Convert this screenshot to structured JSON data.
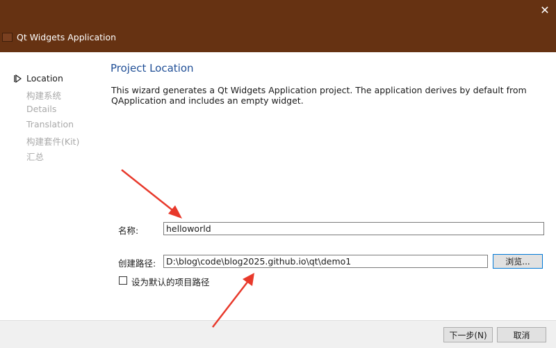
{
  "window": {
    "title": "Qt Widgets Application",
    "close_label": "✕"
  },
  "sidebar": {
    "marker_icon": "triangle-right-icon",
    "steps": [
      {
        "label": "Location",
        "active": true
      },
      {
        "label": "构建系统",
        "active": false
      },
      {
        "label": "Details",
        "active": false
      },
      {
        "label": "Translation",
        "active": false
      },
      {
        "label": "构建套件(Kit)",
        "active": false
      },
      {
        "label": "汇总",
        "active": false
      }
    ]
  },
  "page": {
    "title": "Project Location",
    "description": "This wizard generates a Qt Widgets Application project. The application derives by default from QApplication and includes an empty widget."
  },
  "form": {
    "name_label": "名称:",
    "name_value": "helloworld",
    "path_label": "创建路径:",
    "path_value": "D:\\blog\\code\\blog2025.github.io\\qt\\demo1",
    "browse_label": "浏览...",
    "default_path_label": "设为默认的项目路径",
    "default_path_checked": false
  },
  "footer": {
    "next_label": "下一步(N)",
    "cancel_label": "取消"
  },
  "colors": {
    "titlebar": "#663212",
    "accent_title": "#1f4e96",
    "annotation_arrow": "#e8392b",
    "inactive_step": "#a9a9a9"
  }
}
